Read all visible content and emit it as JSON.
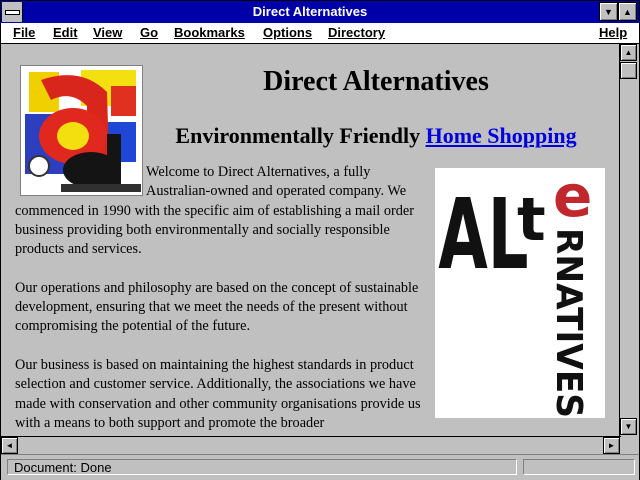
{
  "window": {
    "title": "Direct Alternatives"
  },
  "menubar": {
    "items": [
      "File",
      "Edit",
      "View",
      "Go",
      "Bookmarks",
      "Options",
      "Directory",
      "Help"
    ]
  },
  "page": {
    "heading": "Direct Alternatives",
    "subheading_prefix": "Environmentally Friendly ",
    "subheading_link": "Home Shopping",
    "paragraphs": [
      "Welcome to Direct Alternatives, a fully Australian-owned and operated company. We commenced in 1990 with the specific aim of establishing a mail order business providing both environmentally and socially responsible products and services.",
      "Our operations and philosophy are based on the concept of sustainable development, ensuring that we meet the needs of the present without compromising the potential of the future.",
      "Our business is based on maintaining the highest standards in product selection and customer service. Additionally, the associations we have made with conservation and other community organisations provide us with a means to both support and promote the broader"
    ],
    "logo_right_text": {
      "al": "AL",
      "t": "t",
      "e": "e",
      "rnatives": "RNATIVES"
    },
    "logo_left_text": {
      "a1": "a",
      "a2": "a"
    }
  },
  "status": {
    "text": "Document: Done"
  },
  "icons": [
    "system-menu-icon",
    "minimize-icon",
    "maximize-icon",
    "scroll-up-icon",
    "scroll-down-icon",
    "scroll-left-icon",
    "scroll-right-icon"
  ]
}
